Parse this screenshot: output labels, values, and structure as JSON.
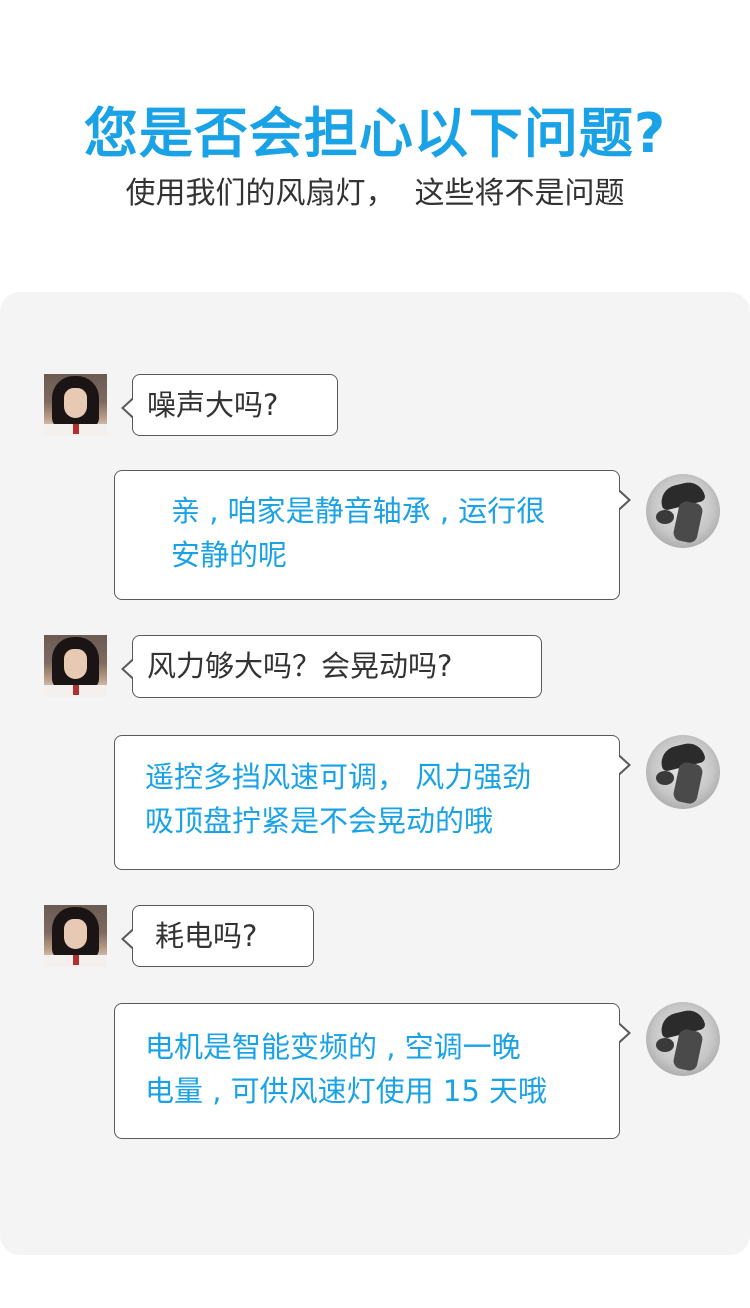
{
  "header": {
    "title": "您是否会担心以下问题?",
    "subtitle": "使用我们的风扇灯，  这些将不是问题"
  },
  "colors": {
    "accent": "#1aa2e6",
    "text": "#333333",
    "panel": "#f4f4f4",
    "bubble_border": "#5a5a5a"
  },
  "conversation": [
    {
      "question": "噪声大吗?",
      "answer": [
        "亲 , 咱家是静音轴承 , 运行很",
        "安静的呢"
      ]
    },
    {
      "question": "风力够大吗？会晃动吗?",
      "answer": [
        "遥控多挡风速可调，  风力强劲",
        "吸顶盘拧紧是不会晃动的哦"
      ]
    },
    {
      "question": "耗电吗?",
      "answer": [
        "电机是智能变频的 , 空调一晚",
        "电量 , 可供风速灯使用 15 天哦"
      ]
    }
  ],
  "avatars": {
    "customer": "girl-avatar-photo",
    "service": "man-avatar-photo"
  }
}
